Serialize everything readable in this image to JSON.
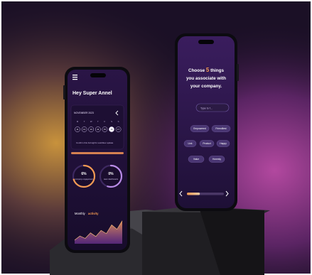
{
  "colors": {
    "backdrop_dark": "#1a0f2a",
    "backdrop_warm": "#c48a3a",
    "backdrop_magenta": "#9a3a8a",
    "screen_purple": "#24123f",
    "accent_orange": "#f39a52",
    "accent_purple": "#a36bd8",
    "pedestal": "#2a2a2e"
  },
  "left_phone": {
    "menu_icon": "hamburger-icon",
    "greeting": "Hey Super Annel",
    "calendar": {
      "month": "NOVEMBER 2023",
      "chevron_icon": "chevron-left-icon",
      "weekdays": [
        "M",
        "T",
        "W",
        "T",
        "F",
        "S",
        "S"
      ],
      "days": [
        "11",
        "12",
        "13",
        "14",
        "15",
        "16",
        "17"
      ],
      "selected_index": 5,
      "caption": "Confirm this fortnight's workflow update"
    },
    "rings": [
      {
        "value": "6%",
        "label": "company engagement",
        "progress": 0.7
      },
      {
        "value": "0%",
        "label": "team dashboards",
        "progress": 0.55
      }
    ],
    "activity": {
      "title": "Monthly",
      "title_accent": "activity",
      "area_values": [
        0.15,
        0.32,
        0.22,
        0.45,
        0.3,
        0.55,
        0.42,
        0.78,
        0.6,
        0.95
      ]
    }
  },
  "right_phone": {
    "heading_pre": "Choose",
    "heading_number": "5",
    "heading_post": "things",
    "heading_line2": "you associate with",
    "heading_line3": "your company.",
    "search_placeholder": "Type to f...",
    "chips": [
      "Empowered",
      "Friendliest",
      "Link",
      "Product",
      "Happy",
      "Value",
      "Honesty"
    ],
    "progress": 0.35,
    "prev_icon": "chevron-left-icon",
    "next_icon": "chevron-right-icon"
  }
}
